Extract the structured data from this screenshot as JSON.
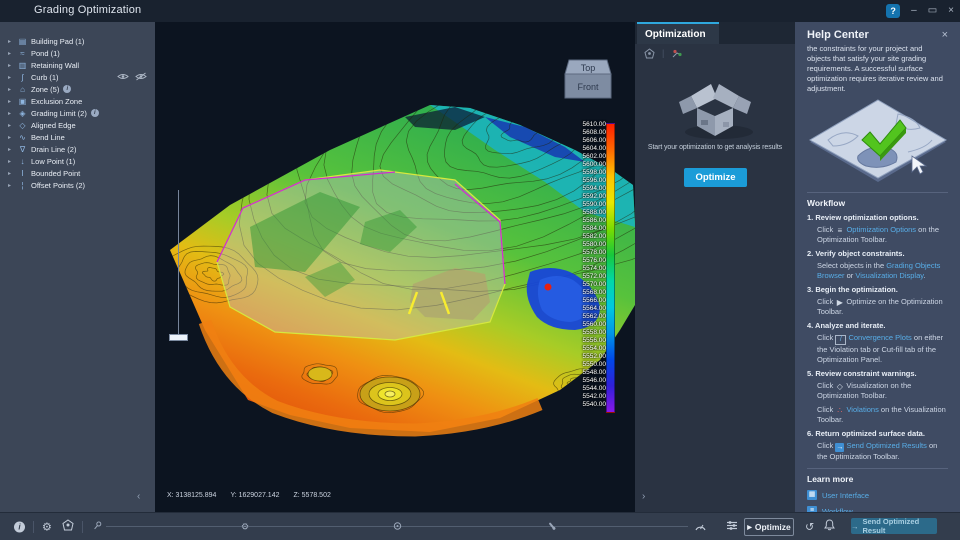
{
  "window": {
    "title": "Grading Optimization"
  },
  "icons": {
    "help": "?",
    "minimize": "–",
    "restore": "▭",
    "close": "×",
    "tree_arrow": "▸",
    "chevron_left": "‹",
    "chevron_right": "›",
    "gear": "⚙",
    "undo": "↺",
    "play": "▶",
    "send_arrow": "→",
    "info": "i",
    "options_sliders": "≡"
  },
  "icon_glyphs": {
    "optimization-options": "≡",
    "play": "▶",
    "convergence-plots": "/",
    "visualization": "◇",
    "violations": "∴",
    "send-results": "→",
    "user-interface": "▦",
    "workflow": "≡"
  },
  "colors": {
    "accent": "#2fa8dd",
    "link": "#58aee8",
    "optimize_button": "#1b9cd8",
    "send_button": "#2c6a8a",
    "legend_ramp": [
      "#ff1e00",
      "#ff6a00",
      "#ffc400",
      "#e8e800",
      "#7adc00",
      "#17c83c",
      "#00d8a8",
      "#00c8e0",
      "#0096e8",
      "#0048e8",
      "#3020d8",
      "#8818e8"
    ]
  },
  "tree": {
    "items": [
      {
        "label": "Building Pad (1)",
        "icon": "building-pad",
        "glyph": "▤"
      },
      {
        "label": "Pond (1)",
        "icon": "pond",
        "glyph": "≈"
      },
      {
        "label": "Retaining Wall",
        "icon": "retaining-wall",
        "glyph": "▥"
      },
      {
        "label": "Curb (1)",
        "icon": "curb",
        "glyph": "∫",
        "eyes": true
      },
      {
        "label": "Zone (5)",
        "icon": "zone",
        "glyph": "⌂",
        "info": true
      },
      {
        "label": "Exclusion Zone",
        "icon": "exclusion-zone",
        "glyph": "▣"
      },
      {
        "label": "Grading Limit (2)",
        "icon": "grading-limit",
        "glyph": "◈",
        "info": true
      },
      {
        "label": "Aligned Edge",
        "icon": "aligned-edge",
        "glyph": "◇"
      },
      {
        "label": "Bend Line",
        "icon": "bend-line",
        "glyph": "∿"
      },
      {
        "label": "Drain Line (2)",
        "icon": "drain-line",
        "glyph": "∇"
      },
      {
        "label": "Low Point (1)",
        "icon": "low-point",
        "glyph": "↓"
      },
      {
        "label": "Bounded Point",
        "icon": "bounded-point",
        "glyph": "I"
      },
      {
        "label": "Offset Points (2)",
        "icon": "offset-points",
        "glyph": "¦"
      }
    ]
  },
  "viewport": {
    "coords": {
      "x": "X: 3138125.894",
      "y": "Y: 1629027.142",
      "z": "Z: 5578.502"
    },
    "viewcube": {
      "top": "Top",
      "front": "Front"
    },
    "legend": {
      "values": [
        "5610.00",
        "5608.00",
        "5606.00",
        "5604.00",
        "5602.00",
        "5600.00",
        "5598.00",
        "5596.00",
        "5594.00",
        "5592.00",
        "5590.00",
        "5588.00",
        "5586.00",
        "5584.00",
        "5582.00",
        "5580.00",
        "5578.00",
        "5576.00",
        "5574.00",
        "5572.00",
        "5570.00",
        "5568.00",
        "5566.00",
        "5564.00",
        "5562.00",
        "5560.00",
        "5558.00",
        "5556.00",
        "5554.00",
        "5552.00",
        "5550.00",
        "5548.00",
        "5546.00",
        "5544.00",
        "5542.00",
        "5540.00"
      ]
    }
  },
  "optimization_panel": {
    "tab": "Optimization",
    "empty_text": "Start your optimization to get analysis results",
    "optimize_button": "Optimize"
  },
  "help": {
    "title": "Help Center",
    "intro": "the constraints for your project and objects that satisfy your site grading requirements. A successful surface optimization requires iterative review and adjustment.",
    "workflow_title": "Workflow",
    "steps": [
      {
        "n": "1.",
        "title": "Review optimization options.",
        "body": [
          [
            {
              "t": "Click "
            },
            {
              "icon": "optimization-options"
            },
            {
              "t": " "
            },
            {
              "link": "Optimization Options"
            },
            {
              "t": " on the Optimization Toolbar."
            }
          ]
        ]
      },
      {
        "n": "2.",
        "title": "Verify object constraints.",
        "body": [
          [
            {
              "t": "Select objects in the "
            },
            {
              "link": "Grading Objects Browser"
            },
            {
              "t": " or "
            },
            {
              "link": "Visualization Display"
            },
            {
              "t": "."
            }
          ]
        ]
      },
      {
        "n": "3.",
        "title": "Begin the optimization.",
        "body": [
          [
            {
              "t": "Click "
            },
            {
              "icon": "play"
            },
            {
              "t": " Optimize on the Optimization Toolbar."
            }
          ]
        ]
      },
      {
        "n": "4.",
        "title": "Analyze and iterate.",
        "body": [
          [
            {
              "t": "Click "
            },
            {
              "icon": "convergence-plots"
            },
            {
              "t": " "
            },
            {
              "link": "Convergence Plots"
            },
            {
              "t": " on either the Violation tab or Cut-fill tab of the Optimization Panel."
            }
          ]
        ]
      },
      {
        "n": "5.",
        "title": "Review constraint warnings.",
        "body": [
          [
            {
              "t": "Click "
            },
            {
              "icon": "visualization"
            },
            {
              "t": " Visualization on the Optimization Toolbar."
            }
          ],
          [
            {
              "t": "Click "
            },
            {
              "icon": "violations"
            },
            {
              "t": " "
            },
            {
              "link": "Violations"
            },
            {
              "t": " on the Visualization Toolbar."
            }
          ]
        ]
      },
      {
        "n": "6.",
        "title": "Return optimized surface data.",
        "body": [
          [
            {
              "t": "Click "
            },
            {
              "icon": "send-results"
            },
            {
              "t": " "
            },
            {
              "link": "Send Optimized Results"
            },
            {
              "t": " on the Optimization Toolbar."
            }
          ]
        ]
      }
    ],
    "learn_more_title": "Learn more",
    "learn_links": [
      {
        "label": "User Interface",
        "icon": "user-interface"
      },
      {
        "label": "Workflow",
        "icon": "workflow"
      }
    ]
  },
  "bottom_toolbar": {
    "optimize_label": "Optimize",
    "send_label": "Send Optimized Result"
  }
}
